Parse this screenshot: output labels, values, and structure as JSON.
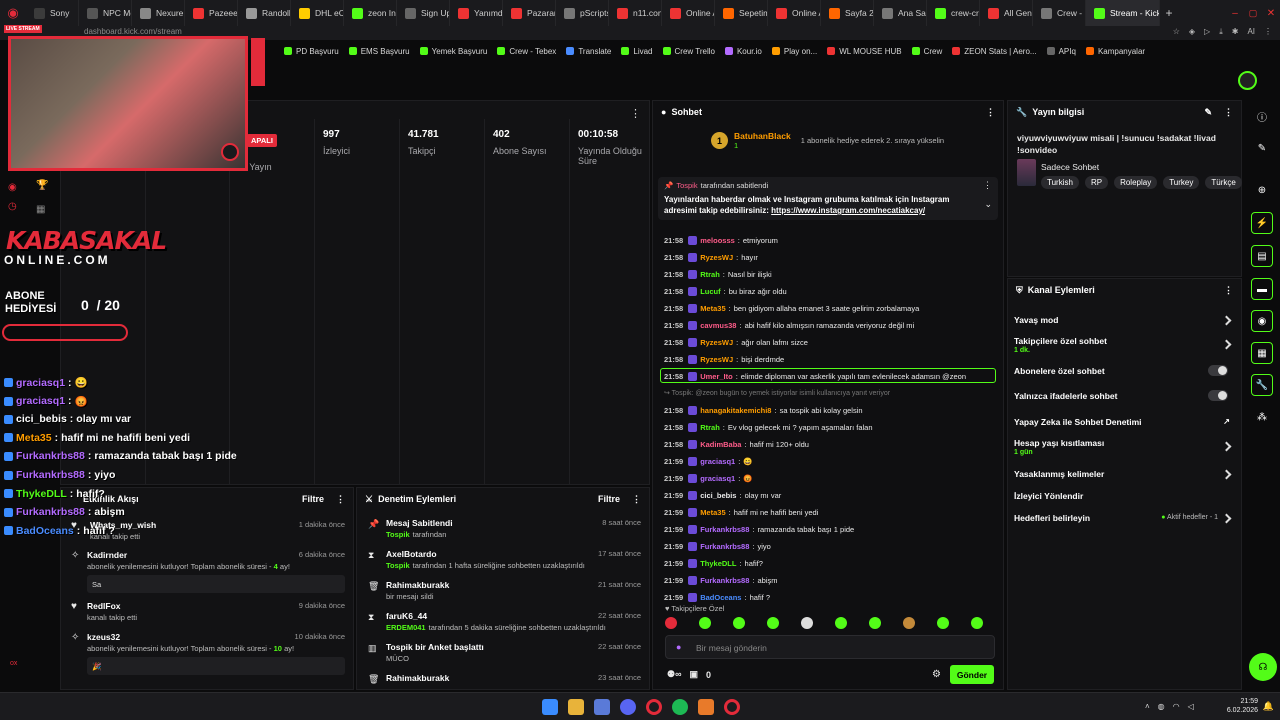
{
  "browser": {
    "tabs": [
      {
        "label": "Sony",
        "color": "#3b3b3b"
      },
      {
        "label": "NPC Mo",
        "color": "#555"
      },
      {
        "label": "Nexure",
        "color": "#888"
      },
      {
        "label": "Pazeee",
        "color": "#e33"
      },
      {
        "label": "Randolli",
        "color": "#999"
      },
      {
        "label": "DHL eCo",
        "color": "#ffcc00"
      },
      {
        "label": "zeon Ins",
        "color": "#53fc18"
      },
      {
        "label": "Sign Up",
        "color": "#666"
      },
      {
        "label": "Yanımda",
        "color": "#e33"
      },
      {
        "label": "Pazaram",
        "color": "#e33"
      },
      {
        "label": "pScripts",
        "color": "#777"
      },
      {
        "label": "n11.com",
        "color": "#e33"
      },
      {
        "label": "Online A",
        "color": "#e33"
      },
      {
        "label": "Sepetim",
        "color": "#f60"
      },
      {
        "label": "Online A",
        "color": "#e33"
      },
      {
        "label": "Sayfa 2",
        "color": "#f60"
      },
      {
        "label": "Ana Say",
        "color": "#777"
      },
      {
        "label": "crew-cra",
        "color": "#53fc18"
      },
      {
        "label": "All Genr",
        "color": "#e33"
      },
      {
        "label": "Crew -",
        "color": "#777"
      },
      {
        "label": "Stream - Kick D",
        "color": "#53fc18",
        "active": true
      }
    ],
    "address": "dashboard.kick.com/stream",
    "bookmarks": [
      {
        "label": "PD Başvuru",
        "color": "#53fc18"
      },
      {
        "label": "EMS Başvuru",
        "color": "#53fc18"
      },
      {
        "label": "Yemek Başvuru",
        "color": "#53fc18"
      },
      {
        "label": "Crew - Tebex",
        "color": "#53fc18"
      },
      {
        "label": "Translate",
        "color": "#4a8cff"
      },
      {
        "label": "Livad",
        "color": "#53fc18"
      },
      {
        "label": "Crew Trello",
        "color": "#53fc18"
      },
      {
        "label": "Kour.io",
        "color": "#b36bff"
      },
      {
        "label": "Play on...",
        "color": "#ff9d00"
      },
      {
        "label": "WL MOUSE HUB",
        "color": "#e33"
      },
      {
        "label": "Crew",
        "color": "#53fc18"
      },
      {
        "label": "ZEON Stats | Aero...",
        "color": "#e33"
      },
      {
        "label": "APIq",
        "color": "#666"
      },
      {
        "label": "Kampanyalar",
        "color": "#f60"
      }
    ]
  },
  "stats": {
    "live_badge": "APALI",
    "items": [
      {
        "value": "",
        "label": "ıklu Yayın"
      },
      {
        "value": "997",
        "label": "İzleyici"
      },
      {
        "value": "41.781",
        "label": "Takipçi"
      },
      {
        "value": "402",
        "label": "Abone Sayısı"
      },
      {
        "value": "00:10:58",
        "label": "Yayında Olduğu Süre"
      }
    ]
  },
  "activity": {
    "title": "Etkinlik Akışı",
    "filter_label": "Filtre",
    "items": [
      {
        "name": "Whats_my_wish",
        "sub": "kanalı takip etti",
        "time": "1 dakika önce"
      },
      {
        "name": "Kadirnder",
        "sub": "abonelik yenilemesini kutluyor! Toplam abonelik süresi -",
        "sub_highlight": "4",
        "sub_suffix": "ay!",
        "box": "Sa",
        "time": "6 dakika önce"
      },
      {
        "name": "RedlFox",
        "sub": "kanalı takip etti",
        "time": "9 dakika önce"
      },
      {
        "name": "kzeus32",
        "sub": "abonelik yenilemesini kutluyor! Toplam abonelik süresi -",
        "sub_highlight": "10",
        "sub_suffix": "ay!",
        "box": "🎉",
        "time": "10 dakika önce"
      }
    ]
  },
  "moderation": {
    "title": "Denetim Eylemleri",
    "filter_label": "Filtre",
    "items": [
      {
        "title": "Mesaj Sabitlendi",
        "actor": "Tospik",
        "detail": "tarafından",
        "time": "8 saat önce"
      },
      {
        "title": "AxelBotardo",
        "actor": "Tospik",
        "detail": "tarafından 1 hafta süreliğine sohbetten uzaklaştırıldı",
        "time": "17 saat önce"
      },
      {
        "title": "Rahimakburakk",
        "actor": "",
        "detail": "bir mesajı sildi",
        "time": "21 saat önce"
      },
      {
        "title": "faruK6_44",
        "actor": "ERDEM041",
        "detail": "tarafından 5 dakika süreliğine sohbetten uzaklaştırıldı",
        "time": "22 saat önce"
      },
      {
        "title": "Tospik bir Anket başlattı",
        "actor": "",
        "detail": "MÜCO",
        "time": "22 saat önce"
      },
      {
        "title": "Rahimakburakk",
        "actor": "",
        "detail": "",
        "time": "23 saat önce"
      }
    ]
  },
  "chat": {
    "title": "Sohbet",
    "top_gifter": {
      "name": "BatuhanBlack",
      "rank": "1",
      "count": "1",
      "text": "1 abonelik hediye ederek 2. sıraya yükselin"
    },
    "pinned": {
      "by": "Tospik",
      "by_suffix": "tarafından sabitlendi",
      "text": "Yayınlardan haberdar olmak ve Instagram grubuma katılmak için Instagram adresimi takip edebilirsiniz:",
      "link": "https://www.instagram.com/necatiakcay/"
    },
    "messages": [
      {
        "time": "21:58",
        "user": "meloosss",
        "color": "#ff5c8a",
        "text": "etmiyorum"
      },
      {
        "time": "21:58",
        "user": "RyzesWJ",
        "color": "#ff9d00",
        "text": "hayır"
      },
      {
        "time": "21:58",
        "user": "Rtrah",
        "color": "#53fc18",
        "text": "Nasıl bir ilişki"
      },
      {
        "time": "21:58",
        "user": "Lucuf",
        "color": "#53fc18",
        "text": "bu biraz ağır oldu"
      },
      {
        "time": "21:58",
        "user": "Meta35",
        "color": "#ff9d00",
        "text": "ben gidiyom allaha emanet 3 saate gelirim zorbalamaya"
      },
      {
        "time": "21:58",
        "user": "cavmus38",
        "color": "#ff5c8a",
        "text": "abi hafif kilo almışsın ramazanda veriyoruz değil mi"
      },
      {
        "time": "21:58",
        "user": "RyzesWJ",
        "color": "#ff9d00",
        "text": "ağır olan lafmı sizce"
      },
      {
        "time": "21:58",
        "user": "RyzesWJ",
        "color": "#ff9d00",
        "text": "bişi derdmde"
      },
      {
        "time": "21:58",
        "user": "Umer_Ito",
        "color": "#ff5c8a",
        "text": "elimde diploman var askerlik yapılı tam evlenilecek adamsın @zeon",
        "highlight": true
      },
      {
        "time": "",
        "user": "",
        "color": "#777",
        "text": "↪ Tospik: @zeon bugün to yemek istiyorlar isimli kullanıcıya yanıt veriyor",
        "reply": true
      },
      {
        "time": "21:58",
        "user": "hanagakitakemichi8",
        "color": "#ff9d00",
        "text": "sa tospik abi kolay gelsin"
      },
      {
        "time": "21:58",
        "user": "Rtrah",
        "color": "#53fc18",
        "text": "Ev vlog gelecek mi ? yapım aşamaları falan"
      },
      {
        "time": "21:58",
        "user": "KadimBaba",
        "color": "#ff5c8a",
        "text": "hafif mi 120+ oldu"
      },
      {
        "time": "21:59",
        "user": "graciasq1",
        "color": "#b36bff",
        "text": "😀"
      },
      {
        "time": "21:59",
        "user": "graciasq1",
        "color": "#b36bff",
        "text": "😡"
      },
      {
        "time": "21:59",
        "user": "cici_bebis",
        "color": "#eaeaea",
        "text": "olay mı var"
      },
      {
        "time": "21:59",
        "user": "Meta35",
        "color": "#ff9d00",
        "text": "hafif mi ne hafifi beni yedi"
      },
      {
        "time": "21:59",
        "user": "Furkankrbs88",
        "color": "#b36bff",
        "text": "ramazanda tabak başı 1 pide"
      },
      {
        "time": "21:59",
        "user": "Furkankrbs88",
        "color": "#b36bff",
        "text": "yiyo"
      },
      {
        "time": "21:59",
        "user": "ThykeDLL",
        "color": "#53fc18",
        "text": "hafif?"
      },
      {
        "time": "21:59",
        "user": "Furkankrbs88",
        "color": "#b36bff",
        "text": "abişm"
      },
      {
        "time": "21:59",
        "user": "BadOceans",
        "color": "#4a8cff",
        "text": "hafif ?"
      }
    ],
    "emote_label": "Takipçilere Özel",
    "input_placeholder": "Bir mesaj gönderin",
    "count": "0",
    "send_label": "Gönder"
  },
  "stream_info": {
    "title": "Yayın bilgisi",
    "stream_title": "viyuwviyuwviyuw misali | !sunucu !sadakat !livad !sonvideo",
    "category": "Sadece Sohbet",
    "tags": [
      "Turkish",
      "RP",
      "Roleplay",
      "Turkey",
      "Türkçe"
    ]
  },
  "channel_actions": {
    "title": "Kanal Eylemleri",
    "rows": [
      {
        "label": "Yavaş mod",
        "type": "chevron"
      },
      {
        "label": "Takipçilere özel sohbet",
        "sub": "1 dk.",
        "type": "chevron"
      },
      {
        "label": "Abonelere özel sohbet",
        "type": "toggle"
      },
      {
        "label": "Yalnızca ifadelerle sohbet",
        "type": "toggle"
      },
      {
        "label": "Yapay Zeka ile Sohbet Denetimi",
        "type": "external"
      },
      {
        "label": "Hesap yaşı kısıtlaması",
        "sub": "1 gün",
        "type": "chevron"
      },
      {
        "label": "Yasaklanmış kelimeler",
        "type": "chevron"
      },
      {
        "label": "İzleyici Yönlendir",
        "type": "none"
      },
      {
        "label": "Hedefleri belirleyin",
        "status": "Aktif hedefler - 1",
        "type": "chevron"
      }
    ]
  },
  "overlay": {
    "live_label": "LIVE STREAM",
    "brand_top": "KABASAKAL",
    "brand_bottom": "ONLINE.COM",
    "goal_label_1": "ABONE",
    "goal_label_2": "HEDİYESİ",
    "goal_value": "0  / 20",
    "chat_lines": [
      {
        "user": "graciasq1",
        "color": "#b36bff",
        "text": "😀"
      },
      {
        "user": "graciasq1",
        "color": "#b36bff",
        "text": "😡"
      },
      {
        "user": "cici_bebis",
        "color": "#ffffff",
        "text": "olay mı var"
      },
      {
        "user": "Meta35",
        "color": "#ff9d00",
        "text": "hafif mi ne hafifi beni yedi"
      },
      {
        "user": "Furkankrbs88",
        "color": "#b36bff",
        "text": "ramazanda tabak başı 1 pide"
      },
      {
        "user": "Furkankrbs88",
        "color": "#b36bff",
        "text": "yiyo"
      },
      {
        "user": "ThykeDLL",
        "color": "#53fc18",
        "text": "hafif?"
      },
      {
        "user": "Furkankrbs88",
        "color": "#b36bff",
        "text": "abişm"
      },
      {
        "user": "BadOceans",
        "color": "#4a8cff",
        "text": "hafif ?"
      }
    ]
  },
  "taskbar": {
    "time": "21:59",
    "date": "6.02.2026"
  },
  "colors": {
    "accent": "#53fc18",
    "live": "#e32b3a"
  }
}
